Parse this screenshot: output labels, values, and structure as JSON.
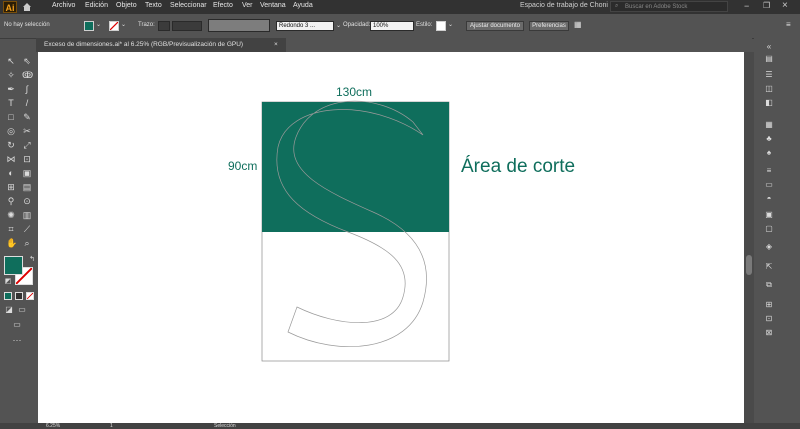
{
  "app": {
    "logo": "Ai",
    "menu": [
      "Archivo",
      "Edición",
      "Objeto",
      "Texto",
      "Seleccionar",
      "Efecto",
      "Ver",
      "Ventana",
      "Ayuda"
    ],
    "workspace": "Espacio de trabajo de Choni",
    "search_placeholder": "Buscar en Adobe Stock"
  },
  "controlbar": {
    "selection": "No hay selección",
    "stroke_label": "Trazo:",
    "brush": "Redondo 3 ...",
    "opacity_label": "Opacidad:",
    "opacity": "100%",
    "style_label": "Estilo:",
    "doc_setup": "Ajustar documento",
    "prefs": "Preferencias"
  },
  "document": {
    "tab_title": "Exceso de dimensiones.ai* al 6.25% (RGB/Previsualización de GPU)",
    "close": "×"
  },
  "artwork": {
    "width_label": "130cm",
    "height_label": "90cm",
    "area_label": "Área de corte",
    "accent": "#0f6e5c"
  },
  "status": {
    "zoom": "6.25%",
    "artboard": "1",
    "mode": "Selección"
  }
}
